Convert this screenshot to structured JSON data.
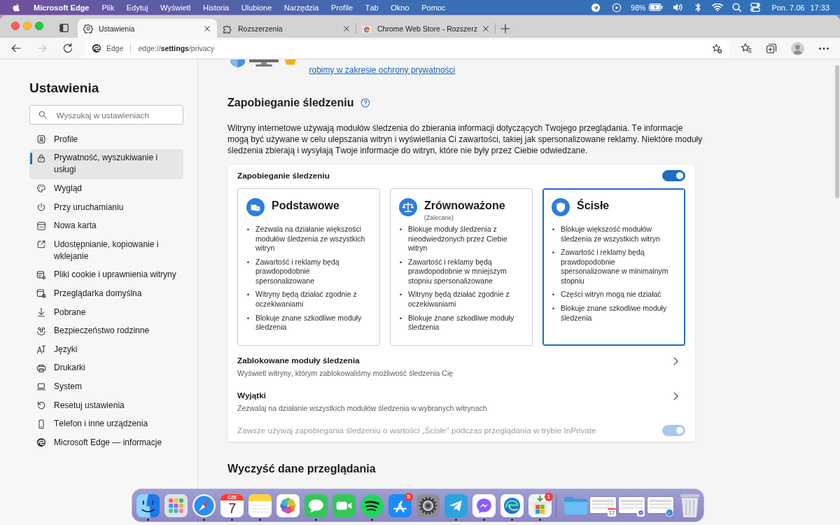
{
  "menu_bar": {
    "app_name": "Microsoft Edge",
    "menus": [
      "Plik",
      "Edytuj",
      "Wyświetl",
      "Historia",
      "Ulubione",
      "Narzędzia",
      "Profile",
      "Tab",
      "Okno",
      "Pomoc"
    ],
    "battery": "98%",
    "date": "Pon. 7.06",
    "time": "17:33"
  },
  "tabs": [
    {
      "title": "Ustawienia",
      "selected": true
    },
    {
      "title": "Rozszerzenia",
      "selected": false
    },
    {
      "title": "Chrome Web Store - Rozszerz",
      "selected": false
    }
  ],
  "toolbar": {
    "back_disabled": false,
    "forward_disabled": true,
    "site_label": "Edge",
    "url": "edge://**settings**/privacy"
  },
  "sidebar": {
    "title": "Ustawienia",
    "search": {
      "placeholder": "Wyszukaj w ustawieniach"
    },
    "items": [
      {
        "label": "Profile",
        "selected": false
      },
      {
        "label": "Prywatność, wyszukiwanie i usługi",
        "selected": true
      },
      {
        "label": "Wygląd",
        "selected": false
      },
      {
        "label": "Przy uruchamianiu",
        "selected": false
      },
      {
        "label": "Nowa karta",
        "selected": false
      },
      {
        "label": "Udostępnianie, kopiowanie i wklejanie",
        "selected": false
      },
      {
        "label": "Pliki cookie i uprawnienia witryny",
        "selected": false
      },
      {
        "label": "Przeglądarka domyślna",
        "selected": false
      },
      {
        "label": "Pobrane",
        "selected": false
      },
      {
        "label": "Bezpieczeństwo rodzinne",
        "selected": false
      },
      {
        "label": "Języki",
        "selected": false
      },
      {
        "label": "Drukarki",
        "selected": false
      },
      {
        "label": "System",
        "selected": false
      },
      {
        "label": "Resetuj ustawienia",
        "selected": false
      },
      {
        "label": "Telefon i inne urządzenia",
        "selected": false
      },
      {
        "label": "Microsoft Edge — informacje",
        "selected": false
      }
    ]
  },
  "page": {
    "privacy_link": "robimy w zakresie ochrony prywatności",
    "heading": "Zapobieganie śledzeniu",
    "description": "Witryny internetowe używają modułów śledzenia do zbierania informacji dotyczących Twojego przeglądania. Te informacje mogą być używane w celu ulepszania witryn i wyświetlania Ci zawartości, takiej jak spersonalizowane reklamy. Niektóre moduły śledzenia zbierają i wysyłają Twoje informacje do witryn, które nie były przez Ciebie odwiedzane.",
    "card": {
      "toggle_label": "Zapobieganie śledzeniu",
      "on": true,
      "levels": [
        {
          "title": "Podstawowe",
          "selected": false,
          "bullets": [
            "Zezwala na działanie większości modułów śledzenia ze wszystkich witryn",
            "Zawartość i reklamy będą prawdopodobnie spersonalizowane",
            "Witryny będą działać zgodnie z oczekiwaniami",
            "Blokuje znane szkodliwe moduły śledzenia"
          ]
        },
        {
          "title": "Zrównoważone",
          "subtitle": "(Zalecane)",
          "selected": false,
          "bullets": [
            "Blokuje moduły śledzenia z nieodwiedzonych przez Ciebie witryn",
            "Zawartość i reklamy będą prawdopodobnie w mniejszym stopniu spersonalizowane",
            "Witryny będą działać zgodnie z oczekiwaniami",
            "Blokuje znane szkodliwe moduły śledzenia"
          ]
        },
        {
          "title": "Ścisłe",
          "selected": true,
          "bullets": [
            "Blokuje większość modułów śledzenia ze wszystkich witryn",
            "Zawartość i reklamy będą prawdopodobnie spersonalizowane w minimalnym stopniu",
            "Części witryn mogą nie działać",
            "Blokuje znane szkodliwe moduły śledzenia"
          ]
        }
      ],
      "rows": [
        {
          "title": "Zablokowane moduły śledzenia",
          "subtitle": "Wyświetl witryny, którym zablokowaliśmy możliwość śledzenia Cię"
        },
        {
          "title": "Wyjątki",
          "subtitle": "Zezwalaj na działanie wszystkich modułów śledzenia w wybranych witrynach"
        }
      ],
      "inprivate": {
        "label": "Zawsze używaj zapobiegania śledzeniu o wartości „Ścisłe” podczas przeglądania w trybie InPrivate",
        "on": true,
        "disabled": true
      }
    },
    "next_heading": "Wyczyść dane przeglądania"
  },
  "dock": {
    "apps": [
      {
        "kind": "app",
        "running": true
      },
      {
        "kind": "app",
        "running": false
      },
      {
        "kind": "app",
        "running": true
      },
      {
        "kind": "calendar",
        "month": "CZE",
        "day": "7",
        "running": true
      },
      {
        "kind": "app",
        "running": true
      },
      {
        "kind": "app",
        "running": false
      },
      {
        "kind": "app",
        "running": true
      },
      {
        "kind": "app",
        "running": false
      },
      {
        "kind": "app",
        "running": true
      },
      {
        "kind": "app",
        "badge": "5",
        "running": false
      },
      {
        "kind": "app",
        "running": false
      },
      {
        "kind": "app",
        "running": true
      },
      {
        "kind": "app",
        "running": true
      },
      {
        "kind": "app",
        "running": true
      },
      {
        "kind": "app",
        "badge": "1",
        "running": true
      }
    ],
    "stacks": [
      {
        "kind": "folder"
      },
      {
        "kind": "window",
        "badge_day": "17"
      },
      {
        "kind": "window"
      },
      {
        "kind": "window"
      },
      {
        "kind": "trash"
      }
    ]
  }
}
